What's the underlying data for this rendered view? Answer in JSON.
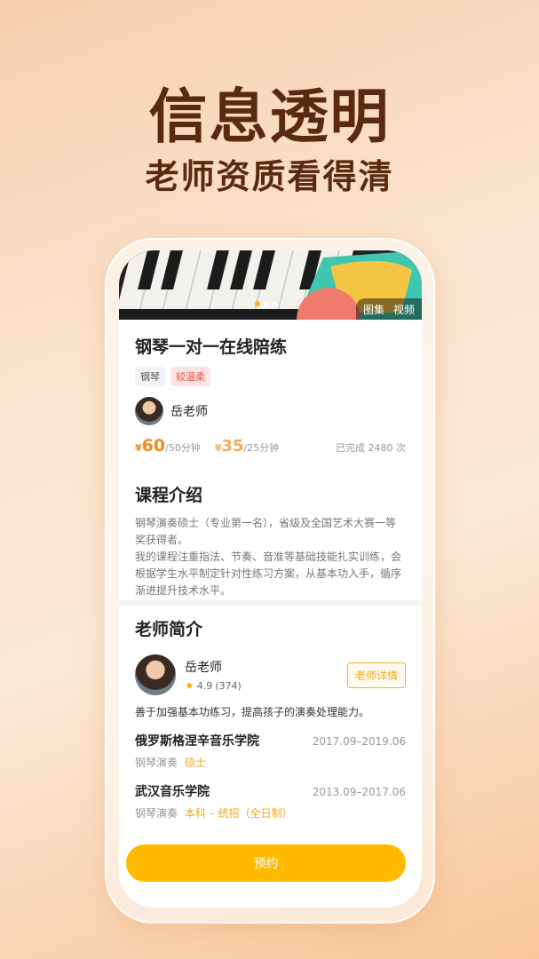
{
  "promo": {
    "headline": "信息透明",
    "subheadline": "老师资质看得清"
  },
  "banner": {
    "gallery_label": "图集",
    "video_label": "视频",
    "page_count": 3,
    "active_page": 1
  },
  "course": {
    "title": "钢琴一对一在线陪练",
    "tags": [
      "钢琴",
      "较温柔"
    ],
    "teacher_name": "岳老师",
    "price1": {
      "currency": "¥",
      "amount": "60",
      "unit": "/50分钟"
    },
    "price2": {
      "currency": "¥",
      "amount": "35",
      "unit": "/25分钟"
    },
    "completed": "已完成 2480 次"
  },
  "intro": {
    "title": "课程介绍",
    "text": "钢琴演奏硕士（专业第一名），省级及全国艺术大赛一等奖获得者。\n我的课程注重指法、节奏、音准等基础技能扎实训练，会根据学生水平制定针对性练习方案，从基本功入手，循序渐进提升技术水平。"
  },
  "teacher": {
    "section_title": "老师简介",
    "name": "岳老师",
    "rating": "4.9",
    "reviews": "(374)",
    "detail_button": "老师详情",
    "bio": "善于加强基本功练习，提高孩子的演奏处理能力。",
    "education": [
      {
        "school": "俄罗斯格涅辛音乐学院",
        "dates": "2017.09–2019.06",
        "major": "钢琴演奏",
        "degree": "硕士"
      },
      {
        "school": "武汉音乐学院",
        "dates": "2013.09–2017.06",
        "major": "钢琴演奏",
        "degree": "本科 – 统招（全日制）"
      }
    ]
  },
  "cta": {
    "book_label": "预约"
  },
  "colors": {
    "accent": "#ffba00",
    "price": "#f08a1c",
    "headline": "#5a2a10"
  }
}
